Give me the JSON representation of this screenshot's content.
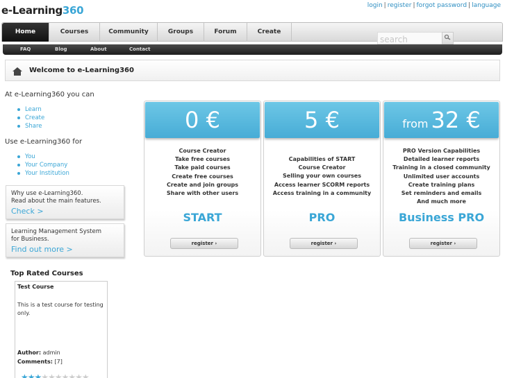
{
  "logo": {
    "main": "e-Learning",
    "accent": "360"
  },
  "toplinks": {
    "login": "login",
    "register": "register",
    "forgot": "forgot password",
    "language": "language",
    "sep": "|"
  },
  "nav": [
    "Home",
    "Courses",
    "Community",
    "Groups",
    "Forum",
    "Create"
  ],
  "search": {
    "placeholder": "search"
  },
  "subnav": [
    "FAQ",
    "Blog",
    "About",
    "Contact"
  ],
  "welcome": {
    "title": "Welcome to e-Learning360"
  },
  "can": {
    "lead": "At e-Learning360 you can",
    "items": [
      "Learn",
      "Create",
      "Share"
    ]
  },
  "use_for": {
    "lead": "Use e-Learning360 for",
    "items": [
      "You",
      "Your Company",
      "Your Institution"
    ]
  },
  "promo1": {
    "line1": "Why use e-Learning360.",
    "line2": "Read about the main features.",
    "link": "Check >"
  },
  "promo2": {
    "line1": "Learning Management System",
    "line2": "for Business.",
    "link": "Find out more >"
  },
  "top_rated": {
    "title": "Top Rated Courses",
    "course": {
      "name": "Test Course",
      "desc": "This is a test course for testing only.",
      "author_label": "Author:",
      "author": "admin",
      "comments_label": "Comments:",
      "comments": "[7]",
      "rating": 3,
      "max_rating": 10
    }
  },
  "plans": [
    {
      "price": "0 €",
      "features": [
        "Course Creator",
        "Take free courses",
        "Take paid courses",
        "Create free courses",
        "Create and join groups",
        "Share with other users"
      ],
      "name": "START",
      "register": "register ›"
    },
    {
      "price": "5 €",
      "features": [
        "Capabilities of START",
        "Course Creator",
        "Selling your own courses",
        "Access learner SCORM reports",
        "Access training in a community"
      ],
      "name": "PRO",
      "register": "register ›"
    },
    {
      "from": "from",
      "price": "32 €",
      "features": [
        "PRO Version Capabilities",
        "Detailed learner reports",
        "Training in a closed community",
        "Unlimited user accounts",
        "Create training plans",
        "Set reminders and emails",
        "And much more"
      ],
      "name": "Business PRO",
      "register": "register ›"
    }
  ],
  "colors": {
    "accent": "#3aa6d6",
    "plan_head": "#5bbbe0",
    "nav_dark": "#1d1d1d"
  }
}
